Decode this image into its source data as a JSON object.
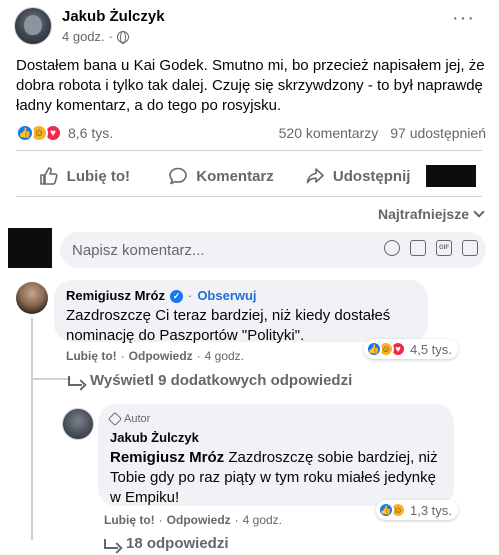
{
  "post": {
    "author": "Jakub Żulczyk",
    "time": "4 godz.",
    "more": "···",
    "text": "Dostałem bana u Kai Godek. Smutno mi, bo przecież napisałem jej, że dobra robota i tylko tak dalej. Czuję się skrzywdzony - to był naprawdę ładny komentarz, a do tego po rosyjsku.",
    "reactions_count": "8,6 tys.",
    "comments_count": "520 komentarzy",
    "shares_count": "97 udostępnień"
  },
  "actions": {
    "like": "Lubię to!",
    "comment": "Komentarz",
    "share": "Udostępnij"
  },
  "sort": {
    "label": "Najtrafniejsze"
  },
  "composer": {
    "placeholder": "Napisz komentarz..."
  },
  "comments": [
    {
      "author": "Remigiusz Mróz",
      "follow": "Obserwuj",
      "text": "Zazdroszczę Ci teraz bardziej, niż kiedy dostałeś nominację do Paszportów \"Polityki\".",
      "like": "Lubię to!",
      "reply": "Odpowiedz",
      "time": "4 godz.",
      "reactions": "4,5 tys.",
      "more_replies": "Wyświetl 9 dodatkowych odpowiedzi"
    },
    {
      "badge": "Autor",
      "author": "Jakub Żulczyk",
      "tag": "Remigiusz Mróz",
      "text": " Zazdroszczę sobie bardziej, niż Tobie gdy po raz piąty w tym roku miałeś jedynkę w Empiku!",
      "like": "Lubię to!",
      "reply": "Odpowiedz",
      "time": "4 godz.",
      "reactions": "1,3 tys.",
      "replies": "18 odpowiedzi"
    }
  ],
  "icons": [
    "globe-icon",
    "like-icon",
    "comment-icon",
    "share-icon",
    "verified-icon",
    "emoji-icon",
    "camera-icon",
    "gif-icon",
    "sticker-icon"
  ],
  "colors": {
    "accent": "#1877f2",
    "like": "#1877f2",
    "haha": "#f7b125",
    "love": "#f0284a",
    "muted": "#65676b"
  }
}
